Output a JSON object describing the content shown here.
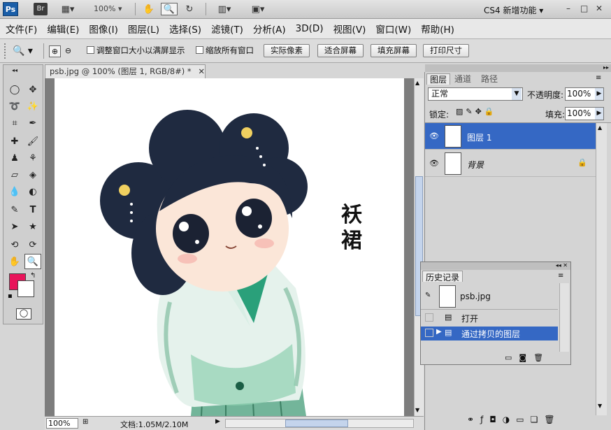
{
  "appbar": {
    "ps_logo": "Ps",
    "bridge": "Br",
    "zoom": "100%",
    "workspace": "CS4 新增功能",
    "min": "–",
    "restore": "□",
    "close": "✕"
  },
  "menu": [
    "文件(F)",
    "编辑(E)",
    "图像(I)",
    "图层(L)",
    "选择(S)",
    "滤镜(T)",
    "分析(A)",
    "3D(D)",
    "视图(V)",
    "窗口(W)",
    "帮助(H)"
  ],
  "options": {
    "resize_window": "调整窗口大小以满屏显示",
    "zoom_all": "缩放所有窗口",
    "actual_pixels": "实际像素",
    "fit_screen": "适合屏幕",
    "fill_screen": "填充屏幕",
    "print_size": "打印尺寸"
  },
  "document": {
    "tab_title": "psb.jpg @ 100% (图层 1, RGB/8#) *",
    "calligraphy_1": "袄",
    "calligraphy_2": "裙"
  },
  "status": {
    "zoom": "100%",
    "doc_info": "文档:1.05M/2.10M"
  },
  "layers_panel": {
    "tabs": [
      "图层",
      "通道",
      "路径"
    ],
    "blend_mode": "正常",
    "opacity_label": "不透明度:",
    "opacity": "100%",
    "lock_label": "锁定:",
    "fill_label": "填充:",
    "fill": "100%",
    "layers": [
      {
        "name": "图层 1",
        "selected": true
      },
      {
        "name": "背景",
        "selected": false
      }
    ]
  },
  "history_panel": {
    "title": "历史记录",
    "snapshot": "psb.jpg",
    "steps": [
      "打开",
      "通过拷贝的图层"
    ],
    "selected_step": 1
  },
  "colors": {
    "foreground": "#e8145a",
    "background": "#ffffff",
    "selection": "#3568c4"
  }
}
